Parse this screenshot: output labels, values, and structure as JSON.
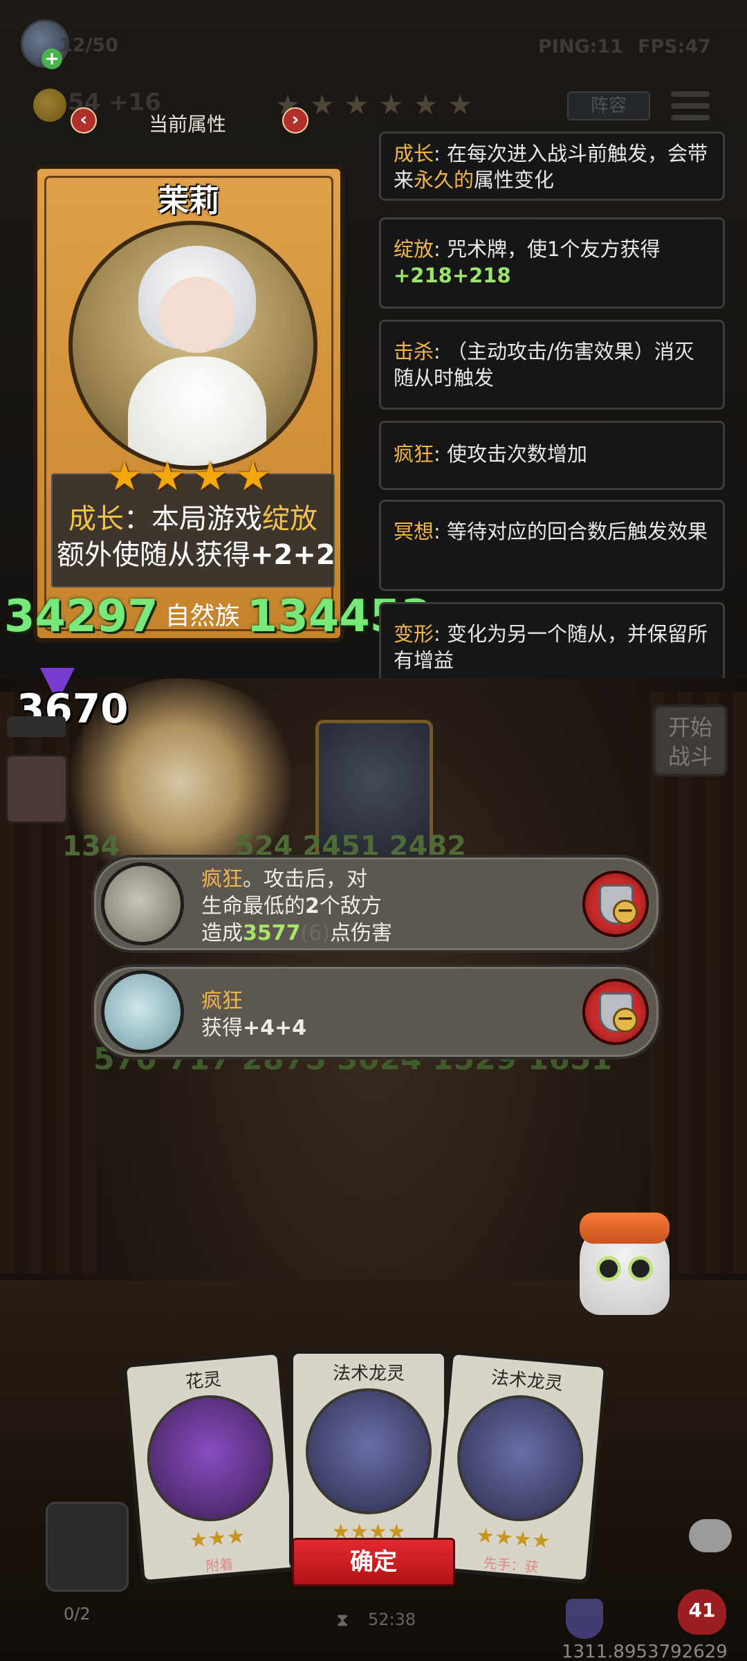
{
  "hud": {
    "population": "12/50",
    "gold": "54 +16",
    "ping": "PING:11",
    "fps": "FPS:47",
    "lineup_label": "阵容"
  },
  "panel": {
    "title": "当前属性",
    "prev": "‹",
    "next": "›"
  },
  "hero": {
    "name": "茉莉",
    "stars": 4,
    "desc_keyword": "成长",
    "desc_line1_mid": "：本局游戏",
    "desc_line1_key2": "绽放",
    "desc_line2": "额外使随从获得",
    "desc_line2_bonus": "+2+2",
    "attack": "34297",
    "tribe": "自然族",
    "health": "134453"
  },
  "keywords": [
    {
      "key": "成长",
      "text": ": 在每次进入战斗前触发，会带来",
      "highlight": "永久的",
      "tail": "属性变化"
    },
    {
      "key": "绽放",
      "text": ": 咒术牌，使1个友方获得",
      "bonus": "+218+218"
    },
    {
      "key": "击杀",
      "text": ": （主动攻击/伤害效果）消灭随从时触发"
    },
    {
      "key": "疯狂",
      "text": ": 使攻击次数增加"
    },
    {
      "key": "冥想",
      "text": ": 等待对应的回合数后触发效果"
    },
    {
      "key": "变形",
      "text": ": 变化为另一个随从，并保留所有增益"
    }
  ],
  "arena": {
    "player_number": "3670",
    "start_label_1": "开始",
    "start_label_2": "战斗",
    "row1_nums": "134",
    "row1_nums_b": "524 2451 2482",
    "row2_nums": "570  717   2875 3024   1529  1651"
  },
  "abilities": [
    {
      "key": "疯狂",
      "line1": "。攻击后，对",
      "line2_pre": "生命最低的",
      "line2_num": "2",
      "line2_post": "个敌方",
      "line3_pre": "造成",
      "line3_num": "3577",
      "line3_dim": "(6)",
      "line3_post": "点伤害"
    },
    {
      "key": "疯狂",
      "line2_pre": "获得",
      "line2_bonus": "+4+4"
    }
  ],
  "hand": [
    {
      "title": "花灵",
      "stars": "★★★",
      "note": "附着"
    },
    {
      "title": "法术龙灵",
      "stars": "★★★★",
      "note": ""
    },
    {
      "title": "法术龙灵",
      "stars": "★★★★",
      "note": "先手：获"
    }
  ],
  "bottom": {
    "confirm_label": "确定",
    "counter": "0/2",
    "timer": "52:38",
    "hp": "41",
    "coords": "1311.8953792629"
  },
  "colors": {
    "keyword": "#f3b64a",
    "bonus_green": "#9be36b",
    "confirm_red": "#e12a2f",
    "stat_green": "#78e87a"
  }
}
